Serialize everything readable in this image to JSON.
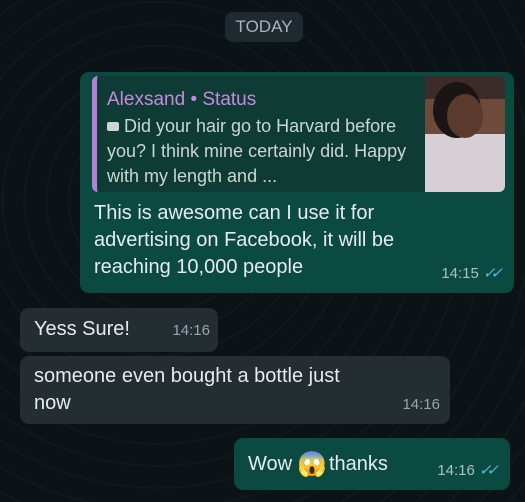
{
  "date_badge": "TODAY",
  "messages": [
    {
      "direction": "outgoing",
      "quote": {
        "author": "Alexsand • Status",
        "icon": "video-camera-icon",
        "text": "Did your hair go to Harvard before you? I think mine certainly did. Happy with my length and ..."
      },
      "text": "This is awesome can I use it for advertising on Facebook, it will be reaching 10,000 people",
      "time": "14:15",
      "status": "read"
    },
    {
      "direction": "incoming",
      "text": "Yess Sure!",
      "time": "14:16"
    },
    {
      "direction": "incoming",
      "text": "someone even bought a bottle just now",
      "time": "14:16"
    },
    {
      "direction": "outgoing",
      "text_before": "Wow",
      "emoji": "😱",
      "text_after": "thanks",
      "time": "14:16",
      "status": "read"
    }
  ],
  "colors": {
    "background": "#0c1317",
    "outgoing": "#0a4a40",
    "incoming": "#232d32",
    "quote_accent": "#b580d6",
    "read_tick": "#53bdeb"
  }
}
